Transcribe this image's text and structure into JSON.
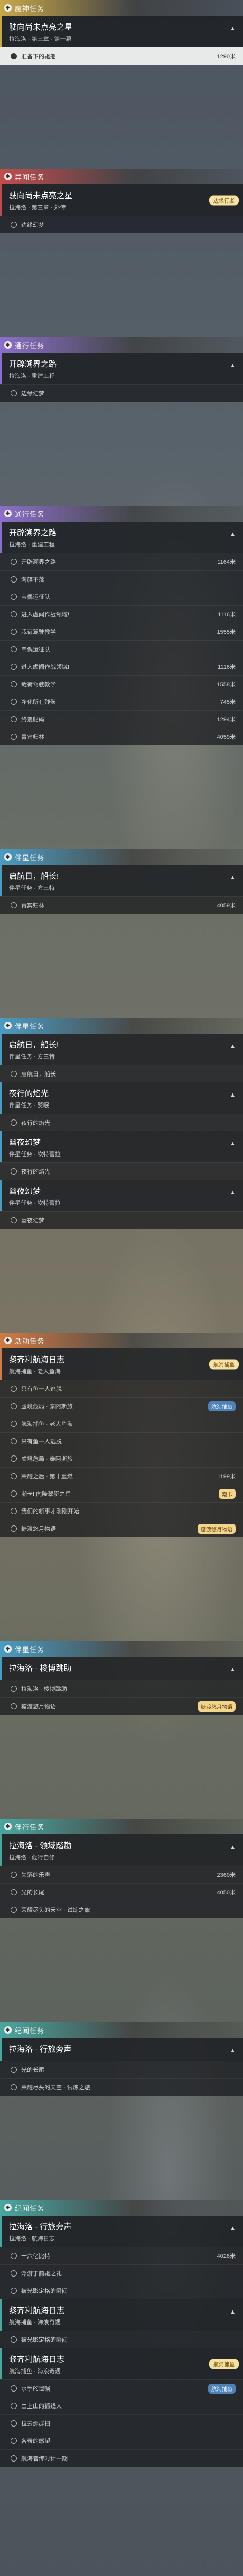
{
  "colors": {
    "archon": "#c9a84a",
    "legend": "#c24c4c",
    "world": "#8c6fc9",
    "event": "#d07a45",
    "travel": "#4aa6a0",
    "commission": "#4b9bc2"
  },
  "sections": [
    {
      "category": "魔神任务",
      "tone": "archon",
      "quests": [
        {
          "title": "驶向尚未点亮之星",
          "sub": "拉海洛 · 第三章 · 第一幕",
          "steps": [
            {
              "label": "准备下的驱船",
              "dist": "1290米",
              "active": true
            }
          ]
        }
      ]
    },
    {
      "category": "异闻任务",
      "tone": "legend",
      "quests": [
        {
          "title": "驶向尚未点亮之星",
          "sub": "拉海洛 · 第三章 · 外传",
          "tag": "边缘行者",
          "steps": [
            {
              "label": "边缘幻梦",
              "dist": ""
            }
          ]
        }
      ]
    },
    {
      "category": "通行任务",
      "tone": "world",
      "quests": [
        {
          "title": "开辟溯界之路",
          "sub": "拉海洛 · 重建工程",
          "steps": [
            {
              "label": "边缘幻梦",
              "dist": ""
            }
          ]
        }
      ]
    },
    {
      "category": "通行任务",
      "tone": "world",
      "quests": [
        {
          "title": "开辟溯界之路",
          "sub": "拉海洛 · 重建工程",
          "steps": [
            {
              "label": "开辟溯界之路",
              "dist": "1164米"
            },
            {
              "label": "淘旗不落",
              "dist": ""
            },
            {
              "label": "韦偶运征队",
              "dist": ""
            },
            {
              "label": "进入虚闻作战领域!",
              "dist": "1116米"
            },
            {
              "label": "栽荷驾驶教学",
              "dist": "1555米"
            },
            {
              "label": "韦偶运征队",
              "dist": ""
            },
            {
              "label": "进入虚闻作战领域!",
              "dist": "1116米"
            },
            {
              "label": "栽荷驾驶教学",
              "dist": "1558米"
            },
            {
              "label": "净化所有残骸",
              "dist": "745米"
            },
            {
              "label": "终遇船码",
              "dist": "1294米"
            },
            {
              "label": "青宾归林",
              "dist": "4059米"
            }
          ]
        }
      ]
    },
    {
      "category": "伴星任务",
      "tone": "commission",
      "quests": [
        {
          "title": "启航日，船长!",
          "sub": "伴星任务 · 方三特",
          "steps": [
            {
              "label": "青宾归林",
              "dist": "4059米"
            }
          ]
        }
      ]
    },
    {
      "category": "伴星任务",
      "tone": "commission",
      "quests": [
        {
          "title": "启航日，船长!",
          "sub": "伴星任务 · 方三特",
          "steps": [
            {
              "label": "启航日，船长!",
              "dist": ""
            }
          ]
        },
        {
          "title": "夜行的焰光",
          "sub": "伴星任务 · 赞眠",
          "steps": [
            {
              "label": "夜行的焰光",
              "dist": ""
            }
          ]
        },
        {
          "title": "幽夜幻梦",
          "sub": "伴星任务 · 坎特蕾拉",
          "steps": [
            {
              "label": "夜行的焰光",
              "dist": ""
            }
          ]
        },
        {
          "title": "幽夜幻梦",
          "sub": "伴星任务 · 坎特蕾拉",
          "steps": [
            {
              "label": "幽夜幻梦",
              "dist": ""
            }
          ]
        }
      ]
    },
    {
      "category": "活动任务",
      "tone": "event",
      "quests": [
        {
          "title": "黎齐利航海日志",
          "sub": "航海捕鱼 · 老人鱼海",
          "tag": "航海捕鱼",
          "steps": [
            {
              "label": "只有鱼一人逃脱",
              "dist": ""
            },
            {
              "label": "虚境危局 · 泰阿斯旅",
              "dist": "",
              "badge": "航海捕鱼"
            },
            {
              "label": "航海捕鱼 · 老人鱼海",
              "dist": ""
            },
            {
              "label": "只有鱼一人逃脱",
              "dist": ""
            },
            {
              "label": "虚境危局 · 泰阿斯旅",
              "dist": ""
            },
            {
              "label": "荣耀之后 · 第十重燃",
              "dist": "1199米"
            },
            {
              "label": "潮卡! 向隆翠艇之岳",
              "dist": "",
              "badge": "潮卡",
              "badgeGold": true
            },
            {
              "label": "我们的新事才刚刚开始",
              "dist": ""
            },
            {
              "label": "糖渡悠月物语",
              "dist": "",
              "badge": "糖渡悠月物语",
              "badgeGold": true
            }
          ]
        }
      ]
    },
    {
      "category": "伴星任务",
      "tone": "commission",
      "quests": [
        {
          "title": "拉海洛 · 梭博跳助",
          "sub": "",
          "steps": [
            {
              "label": "拉海洛 · 梭博跳助",
              "dist": ""
            },
            {
              "label": "糖渡悠月物语",
              "dist": "",
              "badge": "糖渡悠月物语",
              "badgeGold": true
            }
          ]
        }
      ]
    },
    {
      "category": "伴行任务",
      "tone": "travel",
      "quests": [
        {
          "title": "拉海洛 · 领域踏勘",
          "sub": "拉海洛 · 危行自修",
          "steps": [
            {
              "label": "失落的乐声",
              "dist": "2360米"
            },
            {
              "label": "光的长尾",
              "dist": "4050米"
            },
            {
              "label": "荣耀尽头的天空 · 试炼之旅",
              "dist": ""
            }
          ]
        }
      ]
    },
    {
      "category": "纪闻任务",
      "tone": "travel",
      "quests": [
        {
          "title": "拉海洛 · 行旅旁声",
          "sub": "",
          "steps": [
            {
              "label": "光的长尾",
              "dist": ""
            },
            {
              "label": "荣耀尽头的天空 · 试炼之旅",
              "dist": ""
            }
          ]
        }
      ]
    },
    {
      "category": "纪闻任务",
      "tone": "travel",
      "quests": [
        {
          "title": "拉海洛 · 行旅旁声",
          "sub": "拉海洛 · 航海日志",
          "steps": [
            {
              "label": "十六亿比特",
              "dist": "4028米"
            },
            {
              "label": "浮游于前驱之礼",
              "dist": ""
            },
            {
              "label": "被光影定格的瞬间",
              "dist": ""
            }
          ]
        },
        {
          "title": "黎齐利航海日志",
          "sub": "航海捕鱼 · 海浪奇遇",
          "steps": [
            {
              "label": "被光影定格的瞬间",
              "dist": ""
            }
          ]
        },
        {
          "title": "黎齐利航海日志",
          "sub": "航海捕鱼 · 海浪奇遇",
          "tag": "航海捕鱼",
          "steps": [
            {
              "label": "水手的遗嘱",
              "dist": "",
              "badge": "航海捕鱼"
            },
            {
              "label": "由上山的孤线人",
              "dist": ""
            },
            {
              "label": "拉去那群扫",
              "dist": ""
            },
            {
              "label": "各表的感望",
              "dist": ""
            },
            {
              "label": "航海者传时计一期",
              "dist": ""
            }
          ]
        }
      ]
    }
  ]
}
